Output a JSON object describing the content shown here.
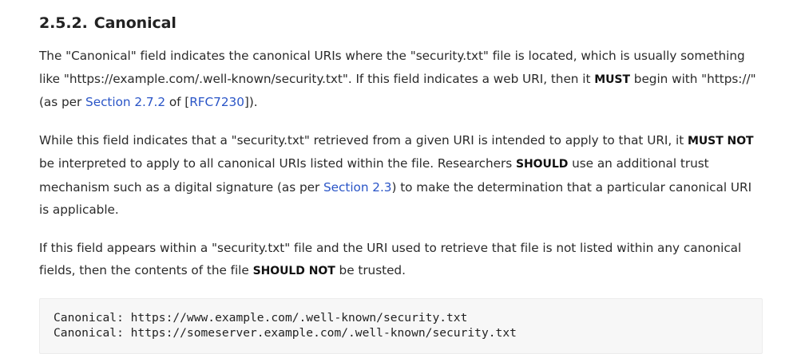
{
  "section": {
    "number": "2.5.2.",
    "title": "Canonical"
  },
  "para1": {
    "t1": "The \"Canonical\" field indicates the canonical URIs where the \"security.txt\" file is located, which is usually something like \"https://example.com/.well-known/security.txt\". If this field indicates a web URI, then it ",
    "must": "MUST",
    "t2": " begin with \"https://\" (as per ",
    "link_section": "Section 2.7.2",
    "t3": " of [",
    "link_rfc": "RFC7230",
    "t4": "])."
  },
  "para2": {
    "t1": "While this field indicates that a \"security.txt\" retrieved from a given URI is intended to apply to that URI, it ",
    "must_not": "MUST NOT",
    "t2": " be interpreted to apply to all canonical URIs listed within the file. Researchers ",
    "should": "SHOULD",
    "t3": " use an additional trust mechanism such as a digital signature (as per ",
    "link_section": "Section 2.3",
    "t4": ") to make the determination that a particular canonical URI is applicable."
  },
  "para3": {
    "t1": "If this field appears within a \"security.txt\" file and the URI used to retrieve that file is not listed within any canonical fields, then the contents of the file ",
    "should_not": "SHOULD NOT",
    "t2": " be trusted."
  },
  "code": {
    "lines": [
      "Canonical: https://www.example.com/.well-known/security.txt",
      "Canonical: https://someserver.example.com/.well-known/security.txt"
    ]
  }
}
